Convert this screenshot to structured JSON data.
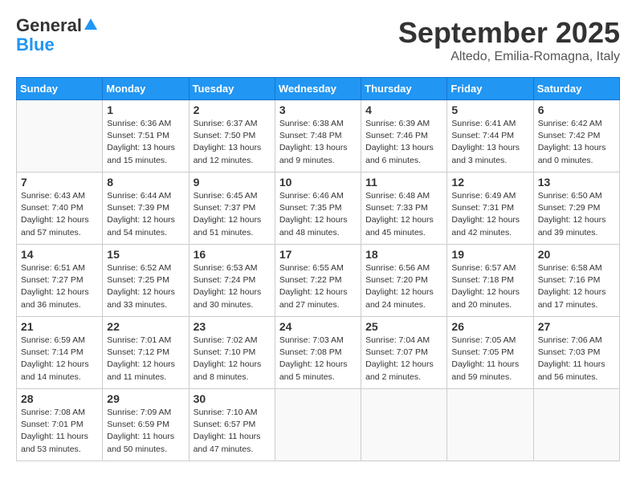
{
  "header": {
    "logo_general": "General",
    "logo_blue": "Blue",
    "month_title": "September 2025",
    "location": "Altedo, Emilia-Romagna, Italy"
  },
  "days_of_week": [
    "Sunday",
    "Monday",
    "Tuesday",
    "Wednesday",
    "Thursday",
    "Friday",
    "Saturday"
  ],
  "weeks": [
    [
      {
        "day": "",
        "info": ""
      },
      {
        "day": "1",
        "info": "Sunrise: 6:36 AM\nSunset: 7:51 PM\nDaylight: 13 hours\nand 15 minutes."
      },
      {
        "day": "2",
        "info": "Sunrise: 6:37 AM\nSunset: 7:50 PM\nDaylight: 13 hours\nand 12 minutes."
      },
      {
        "day": "3",
        "info": "Sunrise: 6:38 AM\nSunset: 7:48 PM\nDaylight: 13 hours\nand 9 minutes."
      },
      {
        "day": "4",
        "info": "Sunrise: 6:39 AM\nSunset: 7:46 PM\nDaylight: 13 hours\nand 6 minutes."
      },
      {
        "day": "5",
        "info": "Sunrise: 6:41 AM\nSunset: 7:44 PM\nDaylight: 13 hours\nand 3 minutes."
      },
      {
        "day": "6",
        "info": "Sunrise: 6:42 AM\nSunset: 7:42 PM\nDaylight: 13 hours\nand 0 minutes."
      }
    ],
    [
      {
        "day": "7",
        "info": "Sunrise: 6:43 AM\nSunset: 7:40 PM\nDaylight: 12 hours\nand 57 minutes."
      },
      {
        "day": "8",
        "info": "Sunrise: 6:44 AM\nSunset: 7:39 PM\nDaylight: 12 hours\nand 54 minutes."
      },
      {
        "day": "9",
        "info": "Sunrise: 6:45 AM\nSunset: 7:37 PM\nDaylight: 12 hours\nand 51 minutes."
      },
      {
        "day": "10",
        "info": "Sunrise: 6:46 AM\nSunset: 7:35 PM\nDaylight: 12 hours\nand 48 minutes."
      },
      {
        "day": "11",
        "info": "Sunrise: 6:48 AM\nSunset: 7:33 PM\nDaylight: 12 hours\nand 45 minutes."
      },
      {
        "day": "12",
        "info": "Sunrise: 6:49 AM\nSunset: 7:31 PM\nDaylight: 12 hours\nand 42 minutes."
      },
      {
        "day": "13",
        "info": "Sunrise: 6:50 AM\nSunset: 7:29 PM\nDaylight: 12 hours\nand 39 minutes."
      }
    ],
    [
      {
        "day": "14",
        "info": "Sunrise: 6:51 AM\nSunset: 7:27 PM\nDaylight: 12 hours\nand 36 minutes."
      },
      {
        "day": "15",
        "info": "Sunrise: 6:52 AM\nSunset: 7:25 PM\nDaylight: 12 hours\nand 33 minutes."
      },
      {
        "day": "16",
        "info": "Sunrise: 6:53 AM\nSunset: 7:24 PM\nDaylight: 12 hours\nand 30 minutes."
      },
      {
        "day": "17",
        "info": "Sunrise: 6:55 AM\nSunset: 7:22 PM\nDaylight: 12 hours\nand 27 minutes."
      },
      {
        "day": "18",
        "info": "Sunrise: 6:56 AM\nSunset: 7:20 PM\nDaylight: 12 hours\nand 24 minutes."
      },
      {
        "day": "19",
        "info": "Sunrise: 6:57 AM\nSunset: 7:18 PM\nDaylight: 12 hours\nand 20 minutes."
      },
      {
        "day": "20",
        "info": "Sunrise: 6:58 AM\nSunset: 7:16 PM\nDaylight: 12 hours\nand 17 minutes."
      }
    ],
    [
      {
        "day": "21",
        "info": "Sunrise: 6:59 AM\nSunset: 7:14 PM\nDaylight: 12 hours\nand 14 minutes."
      },
      {
        "day": "22",
        "info": "Sunrise: 7:01 AM\nSunset: 7:12 PM\nDaylight: 12 hours\nand 11 minutes."
      },
      {
        "day": "23",
        "info": "Sunrise: 7:02 AM\nSunset: 7:10 PM\nDaylight: 12 hours\nand 8 minutes."
      },
      {
        "day": "24",
        "info": "Sunrise: 7:03 AM\nSunset: 7:08 PM\nDaylight: 12 hours\nand 5 minutes."
      },
      {
        "day": "25",
        "info": "Sunrise: 7:04 AM\nSunset: 7:07 PM\nDaylight: 12 hours\nand 2 minutes."
      },
      {
        "day": "26",
        "info": "Sunrise: 7:05 AM\nSunset: 7:05 PM\nDaylight: 11 hours\nand 59 minutes."
      },
      {
        "day": "27",
        "info": "Sunrise: 7:06 AM\nSunset: 7:03 PM\nDaylight: 11 hours\nand 56 minutes."
      }
    ],
    [
      {
        "day": "28",
        "info": "Sunrise: 7:08 AM\nSunset: 7:01 PM\nDaylight: 11 hours\nand 53 minutes."
      },
      {
        "day": "29",
        "info": "Sunrise: 7:09 AM\nSunset: 6:59 PM\nDaylight: 11 hours\nand 50 minutes."
      },
      {
        "day": "30",
        "info": "Sunrise: 7:10 AM\nSunset: 6:57 PM\nDaylight: 11 hours\nand 47 minutes."
      },
      {
        "day": "",
        "info": ""
      },
      {
        "day": "",
        "info": ""
      },
      {
        "day": "",
        "info": ""
      },
      {
        "day": "",
        "info": ""
      }
    ]
  ]
}
